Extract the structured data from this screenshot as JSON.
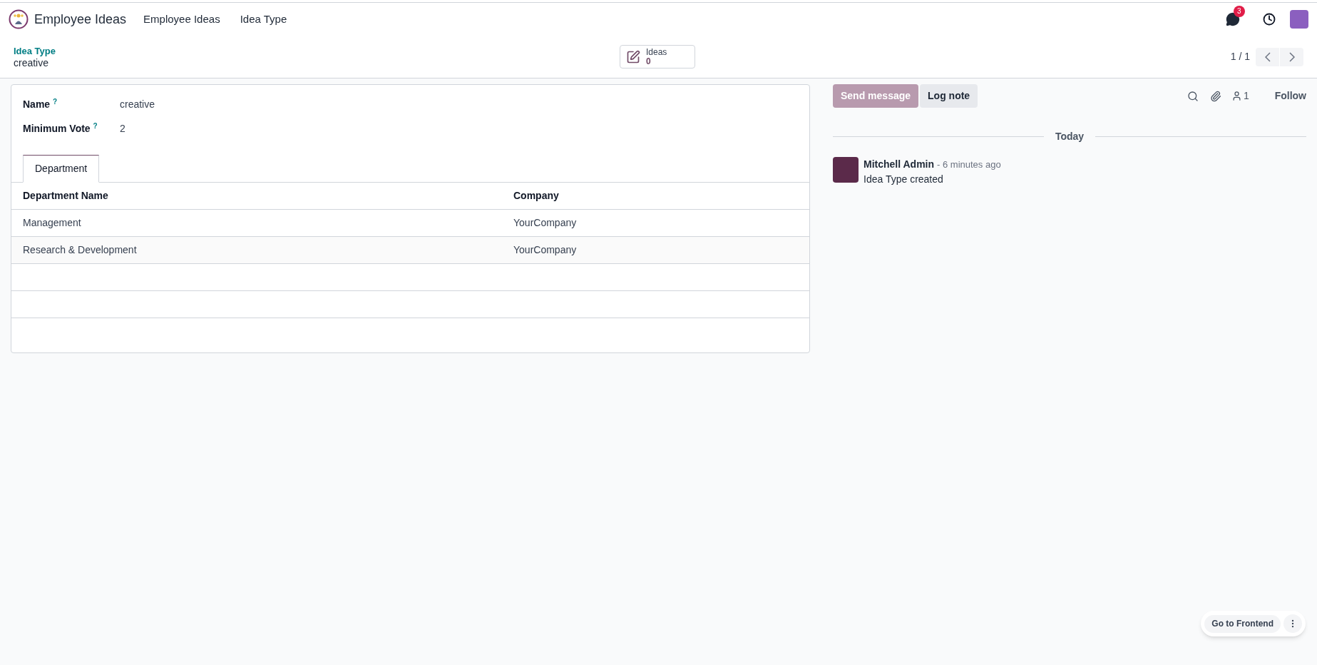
{
  "navbar": {
    "app_name": "Employee Ideas",
    "menu": [
      "Employee Ideas",
      "Idea Type"
    ],
    "messages_badge": "3"
  },
  "breadcrumb": {
    "parent": "Idea Type",
    "current": "creative"
  },
  "smart_button": {
    "label": "Ideas",
    "count": "0"
  },
  "pager": {
    "text": "1 / 1"
  },
  "form": {
    "fields": [
      {
        "label": "Name",
        "help": "?",
        "value": "creative"
      },
      {
        "label": "Minimum Vote",
        "help": "?",
        "value": "2"
      }
    ],
    "tabs": [
      {
        "label": "Department",
        "selected": true
      }
    ],
    "table": {
      "columns": [
        "Department Name",
        "Company"
      ],
      "rows": [
        [
          "Management",
          "YourCompany"
        ],
        [
          "Research & Development",
          "YourCompany"
        ]
      ]
    }
  },
  "chatter": {
    "send_message": "Send message",
    "log_note": "Log note",
    "followers_count": "1",
    "follow": "Follow",
    "date_separator": "Today",
    "messages": [
      {
        "author": "Mitchell Admin",
        "time": "- 6 minutes ago",
        "body": "Idea Type created"
      }
    ]
  },
  "frontend": {
    "label": "Go to Frontend"
  }
}
